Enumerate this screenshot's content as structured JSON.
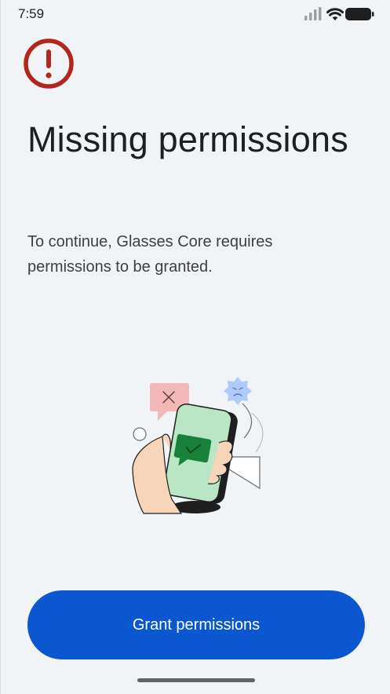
{
  "status_bar": {
    "time": "7:59",
    "icons": [
      "signal-icon",
      "wifi-icon",
      "battery-icon"
    ]
  },
  "warning": {
    "icon": "error-circle-icon",
    "color": "#b3261e"
  },
  "title": "Missing permissions",
  "description": "To continue, Glasses Core requires permissions to be granted.",
  "illustration": {
    "icon": "phone-permissions-illustration"
  },
  "actions": {
    "grant_label": "Grant permissions",
    "grant_color": "#0b57d0"
  }
}
